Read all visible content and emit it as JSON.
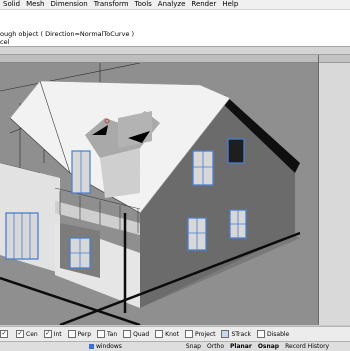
{
  "menu": [
    "Solid",
    "Mesh",
    "Dimension",
    "Transform",
    "Tools",
    "Analyze",
    "Render",
    "Help"
  ],
  "command_history": {
    "line1": "ough object ( Direction=NormalToCurve )",
    "line2": "cel"
  },
  "osnap": [
    {
      "label": "",
      "checked": true
    },
    {
      "label": "Cen",
      "checked": true
    },
    {
      "label": "Int",
      "checked": true
    },
    {
      "label": "Perp",
      "checked": false
    },
    {
      "label": "Tan",
      "checked": false
    },
    {
      "label": "Quad",
      "checked": false
    },
    {
      "label": "Knot",
      "checked": false
    },
    {
      "label": "Project",
      "checked": false
    },
    {
      "label": "STrack",
      "checked": false
    },
    {
      "label": "Disable",
      "checked": false
    }
  ],
  "status": {
    "layer": "windows",
    "snap": "Snap",
    "ortho": "Ortho",
    "planar": "Planar",
    "osnap": "Osnap",
    "record": "Record History"
  },
  "colors": {
    "viewport_bg": "#8f8f8f",
    "wall": "#dadada",
    "wall_shadow": "#6f6f6f",
    "roof": "#efefef",
    "window_frame": "#4a7fd0",
    "grid_axis": "#111111"
  }
}
